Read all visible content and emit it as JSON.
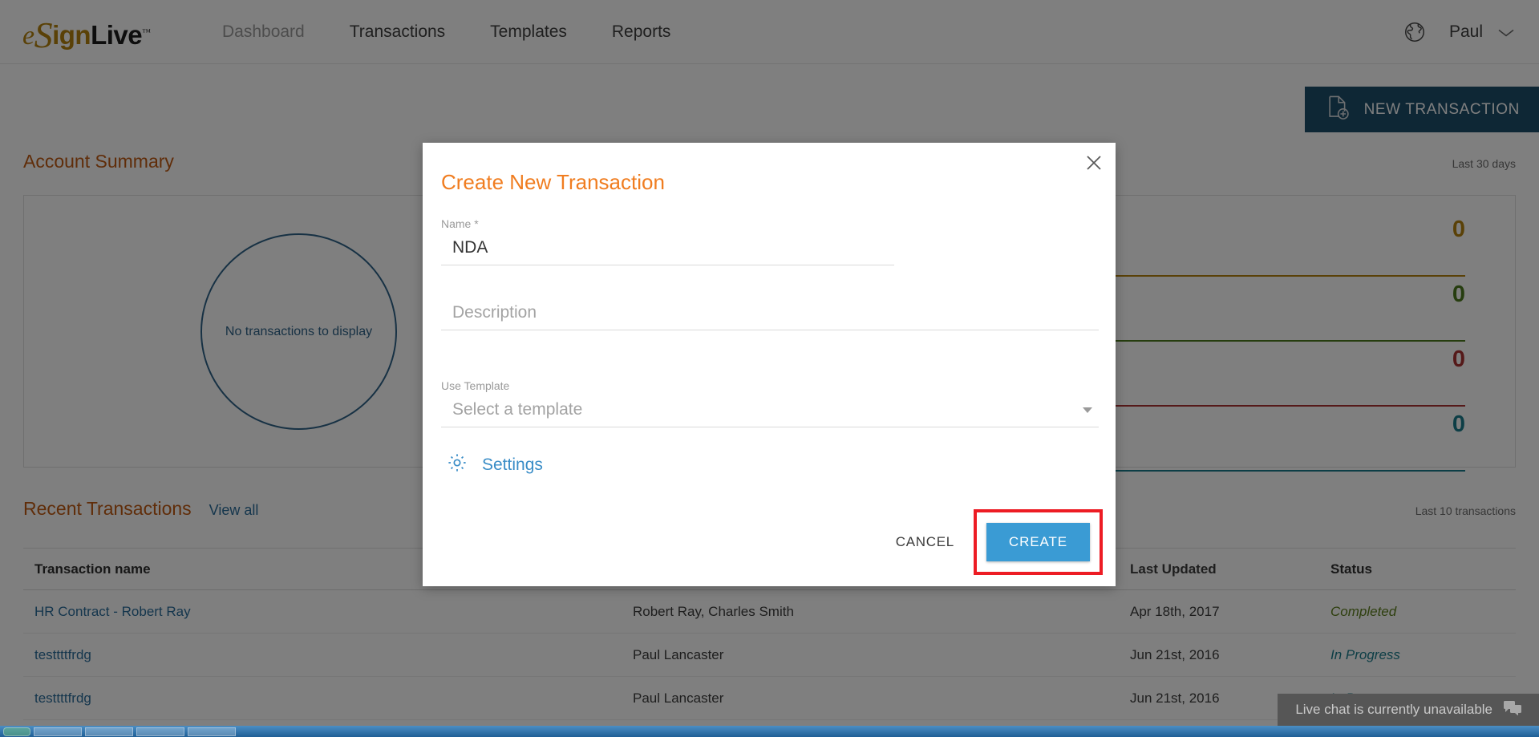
{
  "header": {
    "logo": {
      "part1": "e",
      "part2": "S",
      "part3": "ign",
      "part4": "Live",
      "tm": "™"
    },
    "nav": [
      {
        "label": "Dashboard",
        "active": true
      },
      {
        "label": "Transactions",
        "active": false
      },
      {
        "label": "Templates",
        "active": false
      },
      {
        "label": "Reports",
        "active": false
      }
    ],
    "language_icon": "globe-icon",
    "user": "Paul",
    "user_chevron_icon": "chevron-down-icon"
  },
  "toolbar": {
    "new_transaction_label": "NEW TRANSACTION",
    "new_transaction_icon": "document-add-icon",
    "new_transaction_color": "#1d4e6b"
  },
  "account_summary": {
    "title": "Account Summary",
    "range": "Last 30 days",
    "donut_empty_text": "No transactions to display",
    "donut_color": "#2e6389",
    "stats": [
      {
        "value": "0",
        "color": "#b5830f"
      },
      {
        "value": "0",
        "color": "#4d7a1e"
      },
      {
        "value": "0",
        "color": "#ab3333"
      },
      {
        "value": "0",
        "color": "#1b7c8c"
      }
    ]
  },
  "recent_transactions": {
    "title": "Recent Transactions",
    "view_all": "View all",
    "range": "Last 10 transactions",
    "columns": [
      "Transaction name",
      "",
      "Last Updated",
      "Status"
    ],
    "rows": [
      {
        "name": "HR Contract - Robert Ray",
        "people": "Robert Ray, Charles Smith",
        "updated": "Apr 18th, 2017",
        "status": "Completed",
        "status_color": "#5d7e1d"
      },
      {
        "name": "testtttfrdg",
        "people": "Paul Lancaster",
        "updated": "Jun 21st, 2016",
        "status": "In Progress",
        "status_color": "#1b7c8c"
      },
      {
        "name": "testtttfrdg",
        "people": "Paul Lancaster",
        "updated": "Jun 21st, 2016",
        "status": "In Progress",
        "status_color": "#1b7c8c"
      }
    ]
  },
  "live_chat": {
    "label": "Live chat is currently unavailable",
    "icon": "chat-bubbles-icon"
  },
  "modal": {
    "title": "Create New Transaction",
    "close_icon": "close-icon",
    "name_label": "Name *",
    "name_value": "NDA",
    "name_placeholder": "",
    "description_label": "",
    "description_value": "",
    "description_placeholder": "Description",
    "template_label": "Use Template",
    "template_value": "",
    "template_placeholder": "Select a template",
    "template_caret_icon": "chevron-down-icon",
    "settings_label": "Settings",
    "settings_icon": "gear-icon",
    "cancel_label": "CANCEL",
    "create_label": "CREATE",
    "create_color": "#3a9bd4",
    "highlight_color": "#ed1c24",
    "title_color": "#f07d20"
  }
}
